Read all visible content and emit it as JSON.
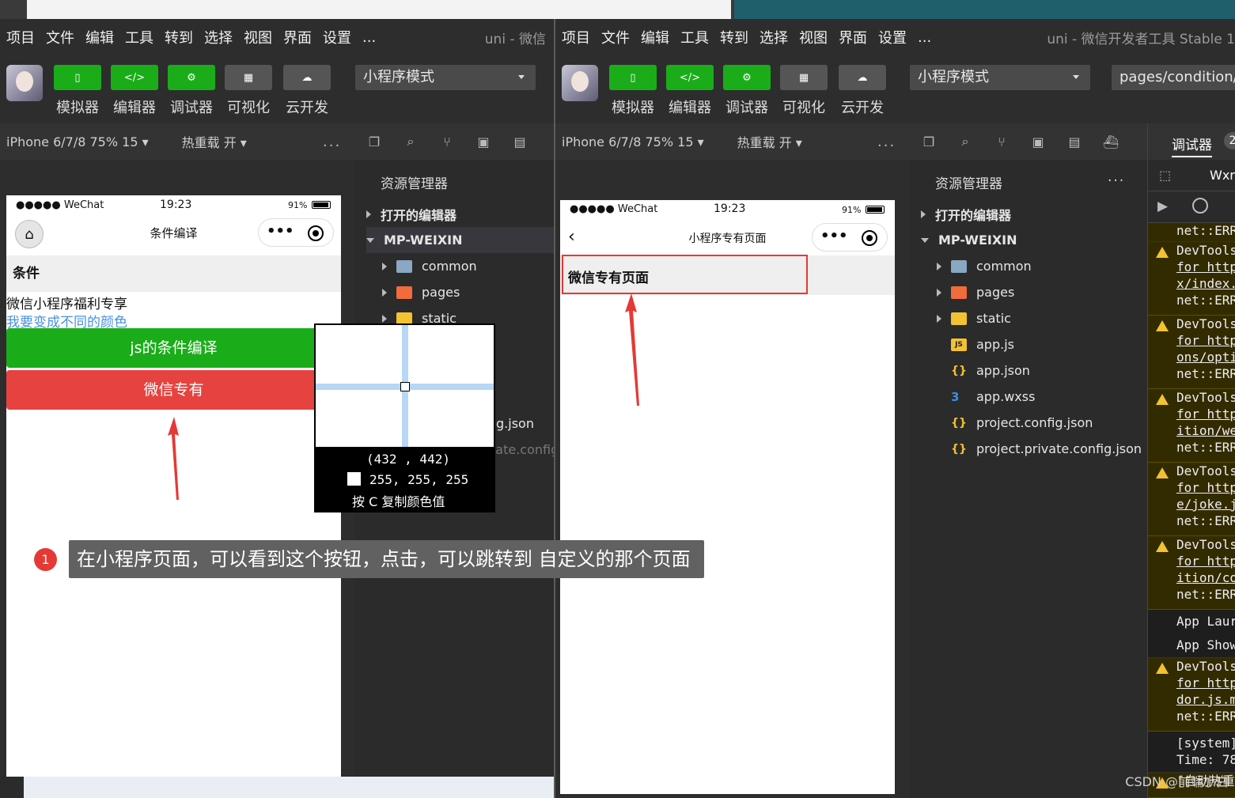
{
  "menu": {
    "items": [
      "项目",
      "文件",
      "编辑",
      "工具",
      "转到",
      "选择",
      "视图",
      "界面",
      "设置",
      "..."
    ],
    "left_title": "uni - 微信",
    "right_title": "uni - 微信开发者工具 Stable 1"
  },
  "toolbar": {
    "buttons": [
      "模拟器",
      "编辑器",
      "调试器",
      "可视化",
      "云开发"
    ],
    "mode": "小程序模式",
    "path": "pages/condition/c"
  },
  "devbar": {
    "device": "iPhone 6/7/8 75% 15 ▾",
    "hot_reload": "热重载 开 ▾",
    "more": "..."
  },
  "left_phone": {
    "status_carrier": "●●●●● WeChat",
    "status_time": "19:23",
    "status_battery": "91%",
    "nav_title": "条件编译",
    "section_title": "条件",
    "text1": "微信小程序福利专享",
    "link_text": "我要变成不同的颜色",
    "btn_green": "js的条件编译",
    "btn_red": "微信专有"
  },
  "right_phone": {
    "status_carrier": "●●●●● WeChat",
    "status_time": "19:23",
    "status_battery": "91%",
    "nav_title": "小程序专有页面",
    "page_text": "微信专有页面"
  },
  "explorer": {
    "title": "资源管理器",
    "more": "...",
    "open_editors": "打开的编辑器",
    "project": "MP-WEIXIN",
    "files": [
      "common",
      "pages",
      "static",
      "app.js",
      "app.json",
      "app.wxss",
      "project.config.json",
      "project.private.config.json"
    ],
    "left_partial_1": "g.json",
    "left_partial_2": "project.private.config.js"
  },
  "debugger": {
    "tab": "调试器",
    "badge": "2",
    "wxml_tab": "Wxr",
    "lines": {
      "l0": "net::ERR",
      "w1a": "DevTools",
      "w1b": "for http",
      "w1c": "x/index.",
      "w1d": "net::ERR",
      "w2a": "DevTools",
      "w2b": "for http",
      "w2c": "ons/opti",
      "w2d": "net::ERR",
      "w3a": "DevTools",
      "w3b": "for http",
      "w3c": "ition/we",
      "w3d": "net::ERR",
      "w4a": "DevTools",
      "w4b": "for http",
      "w4c": "e/joke.j",
      "w4d": "net::ERR",
      "w5a": "DevTools",
      "w5b": "for http",
      "w5c": "ition/co",
      "w5d": "net::ERR",
      "app1": "App Laur",
      "app2": "App Show",
      "w6a": "DevTools",
      "w6b": "for http",
      "w6c": "dor.js.m",
      "w6d": "net::ERR",
      "sys1": "[system]",
      "sys2": "Time: 78",
      "sys3": "[自动热重"
    }
  },
  "magnifier": {
    "coords": "(432 , 442)",
    "rgb": "255, 255, 255",
    "hint": "按 C 复制颜色值"
  },
  "annotation": {
    "number": "1",
    "text": "在小程序页面，可以看到这个按钮，点击，可以跳转到 自定义的那个页面"
  },
  "watermark": "CSDN @前端小白"
}
